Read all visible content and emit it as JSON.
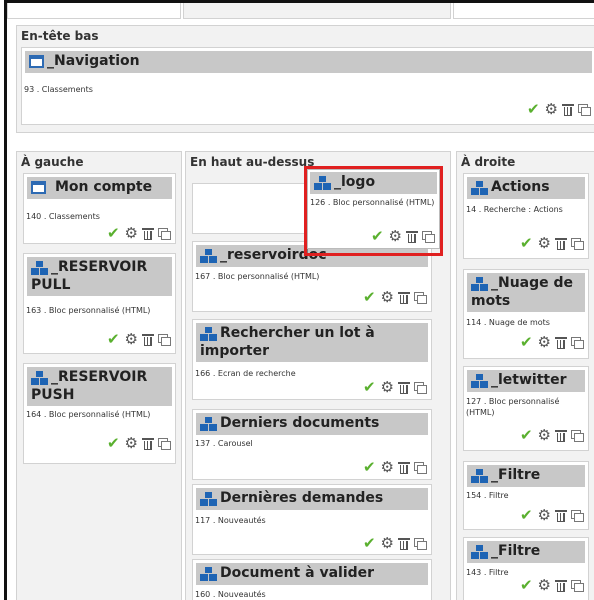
{
  "zones": {
    "header_bottom": "En-tête bas",
    "left": "À gauche",
    "top_above": "En haut au-dessus",
    "right": "À droite"
  },
  "blocks": {
    "navigation": {
      "title": "_Navigation",
      "desc": "93 . Classements"
    },
    "mon_compte": {
      "title": "Mon compte",
      "desc": "140 . Classements"
    },
    "reservoir_pull": {
      "title": "_RESERVOIR PULL",
      "desc": "163 . Bloc personnalisé (HTML)"
    },
    "reservoir_push": {
      "title": "_RESERVOIR PUSH",
      "desc": "164 . Bloc personnalisé (HTML)"
    },
    "logo": {
      "title": "_logo",
      "desc": "126 . Bloc personnalisé (HTML)"
    },
    "reservoirdoc": {
      "title": "_reservoirdoc",
      "desc": "167 . Bloc personnalisé (HTML)"
    },
    "rechercher_lot": {
      "title": "Rechercher un lot à importer",
      "desc": "166 . Ecran de recherche"
    },
    "derniers_documents": {
      "title": "Derniers documents",
      "desc": "137 . Carousel"
    },
    "dernieres_demandes": {
      "title": "Dernières demandes",
      "desc": "117 . Nouveautés"
    },
    "document_valider": {
      "title": "Document à valider",
      "desc": "160 . Nouveautés"
    },
    "actions": {
      "title": "Actions",
      "desc": "14 . Recherche : Actions"
    },
    "nuage_mots": {
      "title": "_Nuage de mots",
      "desc": "114 . Nuage de mots"
    },
    "letwitter": {
      "title": "_letwitter",
      "desc": "127 . Bloc personnalisé (HTML)"
    },
    "filtre1": {
      "title": "_Filtre",
      "desc": "154 . Filtre"
    },
    "filtre2": {
      "title": "_Filtre",
      "desc": "143 . Filtre"
    }
  },
  "icons": {
    "check": "checkmark-icon",
    "gear": "gear-icon",
    "trash": "trash-icon",
    "copy": "copy-icon"
  },
  "colors": {
    "check": "#5ab02f",
    "block_icon": "#1e64b4",
    "highlight": "#e02020",
    "zone_bg": "#f2f2f2",
    "header_bg": "#c8c8c8"
  }
}
